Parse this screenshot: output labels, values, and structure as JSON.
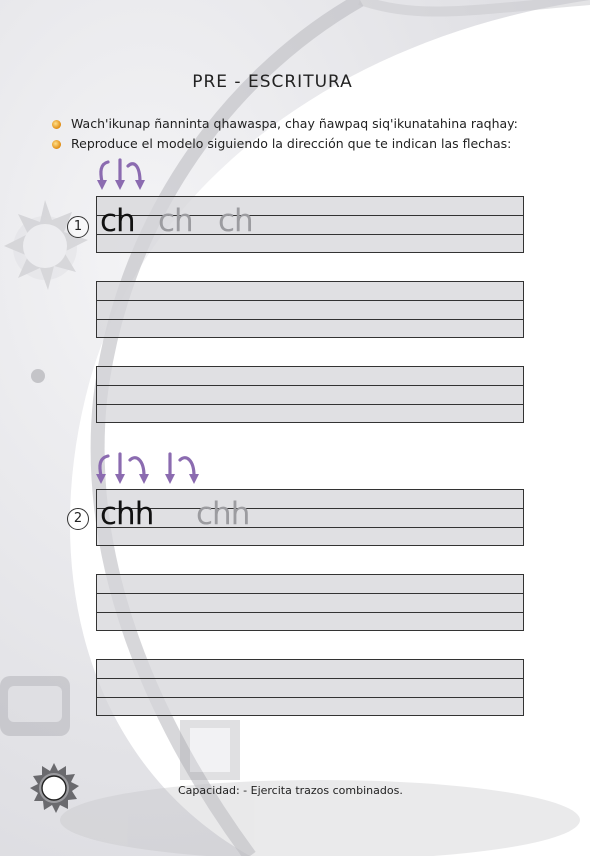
{
  "title": "PRE - ESCRITURA",
  "instructions": [
    "Wach'ikunap ñanninta qhawaspa, chay ñawpaq siq'ikunatahina raqhay:",
    "Reproduce el modelo siguiendo la dirección que te indican las  flechas:"
  ],
  "exercises": [
    {
      "number": "1",
      "model": "ch",
      "ghosts": [
        "ch",
        "ch"
      ]
    },
    {
      "number": "2",
      "model": "chh",
      "ghosts": [
        "chh"
      ]
    }
  ],
  "footer": "Capacidad: - Ejercita trazos combinados.",
  "colors": {
    "arrow": "#8b6bb0",
    "ghost": "#9c9ca0",
    "band": "#d6d6da",
    "bullet": "#e08a10"
  },
  "icons": [
    "bullet-icon",
    "curved-arrow-icon",
    "down-arrow-icon",
    "sun-badge-icon"
  ]
}
